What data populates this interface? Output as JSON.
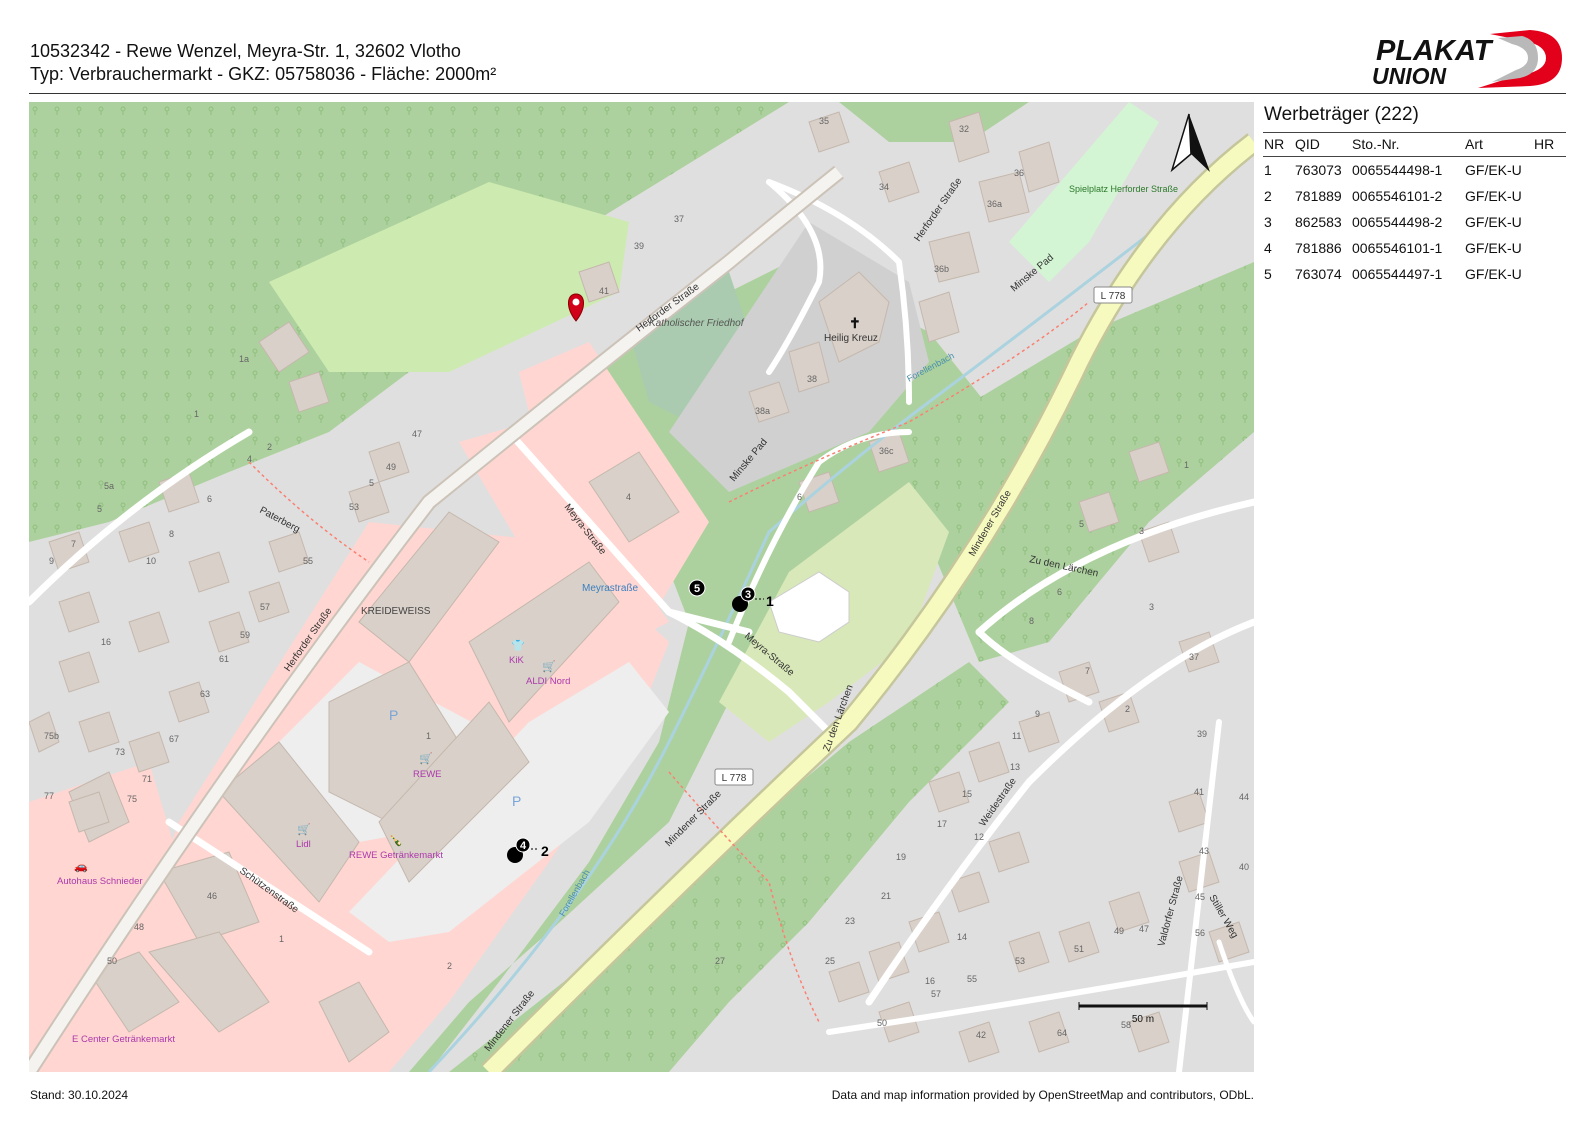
{
  "header": {
    "line1": "10532342 - Rewe Wenzel, Meyra-Str. 1, 32602 Vlotho",
    "line2": "Typ: Verbrauchermarkt - GKZ: 05758036 - Fläche: 2000m²"
  },
  "logo": {
    "line1": "PLAKAT",
    "line2": "UNION",
    "accent": "#e3001b"
  },
  "panel": {
    "title": "Werbeträger (222)",
    "columns": [
      "NR",
      "QID",
      "Sto.-Nr.",
      "Art",
      "HR"
    ],
    "rows": [
      [
        "1",
        "763073",
        "0065544498-1",
        "GF/EK-U",
        ""
      ],
      [
        "2",
        "781889",
        "0065546101-2",
        "GF/EK-U",
        ""
      ],
      [
        "3",
        "862583",
        "0065544498-2",
        "GF/EK-U",
        ""
      ],
      [
        "4",
        "781886",
        "0065546101-1",
        "GF/EK-U",
        ""
      ],
      [
        "5",
        "763074",
        "0065544497-1",
        "GF/EK-U",
        ""
      ]
    ]
  },
  "map": {
    "colors": {
      "forest": "#add19e",
      "park": "#c8facc",
      "retail": "#ffd6d1",
      "residential": "#e0dfdf",
      "building": "#d9d0c9",
      "road": "#ffffff",
      "primary": "#f7fabf",
      "primary_casing": "#c5c69b",
      "water": "#aad3df",
      "poi": "#ac39ac"
    },
    "roads": [
      "Herforder Straße",
      "Herforder Straße",
      "Herforder Straße",
      "Meyra-Straße",
      "Meyra-Straße",
      "Minske Pad",
      "Minske Pad",
      "Mindener Straße",
      "Mindener Straße",
      "Mindener Straße",
      "Paterberg",
      "Schützenstraße",
      "Zu den Lärchen",
      "Zu den Lärchen",
      "Weidestraße",
      "Valdorfer Straße",
      "Stiller Weg",
      "Forellenbach",
      "Forellenbach"
    ],
    "route_ref": "L 778",
    "places": [
      "Katholischer Friedhof",
      "Heilig Kreuz",
      "Spielplatz Herforder Straße",
      "KREIDEWEISS",
      "Meyrastraße"
    ],
    "pois": [
      "KiK",
      "ALDI Nord",
      "REWE",
      "Lidl",
      "REWE Getränkemarkt",
      "Autohaus Schnieder",
      "E Center Getränkemarkt"
    ],
    "house_numbers": [
      "35",
      "32",
      "34",
      "36",
      "36a",
      "36b",
      "37",
      "39",
      "41",
      "1a",
      "1",
      "2",
      "4",
      "5a",
      "5",
      "6",
      "7",
      "8",
      "9",
      "10",
      "16",
      "47",
      "49",
      "5",
      "53",
      "55",
      "57",
      "59",
      "61",
      "63",
      "67",
      "71",
      "73",
      "75",
      "75b",
      "77",
      "38",
      "38a",
      "36c",
      "6",
      "4",
      "1",
      "46",
      "48",
      "50",
      "1",
      "2",
      "27",
      "23",
      "25",
      "19",
      "21",
      "17",
      "15",
      "16",
      "14",
      "13",
      "12",
      "11",
      "9",
      "7",
      "2",
      "8",
      "6",
      "5",
      "3",
      "3",
      "1",
      "37",
      "39",
      "41",
      "43",
      "45",
      "47",
      "49",
      "51",
      "53",
      "55",
      "57",
      "50",
      "56",
      "58",
      "64",
      "42",
      "44",
      "40"
    ],
    "scale_label": "50 m",
    "markers": [
      {
        "nr": "1",
        "label": "1"
      },
      {
        "nr": "2",
        "label": "2"
      },
      {
        "nr": "3",
        "label": "3"
      },
      {
        "nr": "4",
        "label": "4"
      },
      {
        "nr": "5",
        "label": "5"
      }
    ]
  },
  "footer": {
    "stand": "Stand: 30.10.2024",
    "attribution": "Data and map information provided by OpenStreetMap and contributors, ODbL."
  }
}
